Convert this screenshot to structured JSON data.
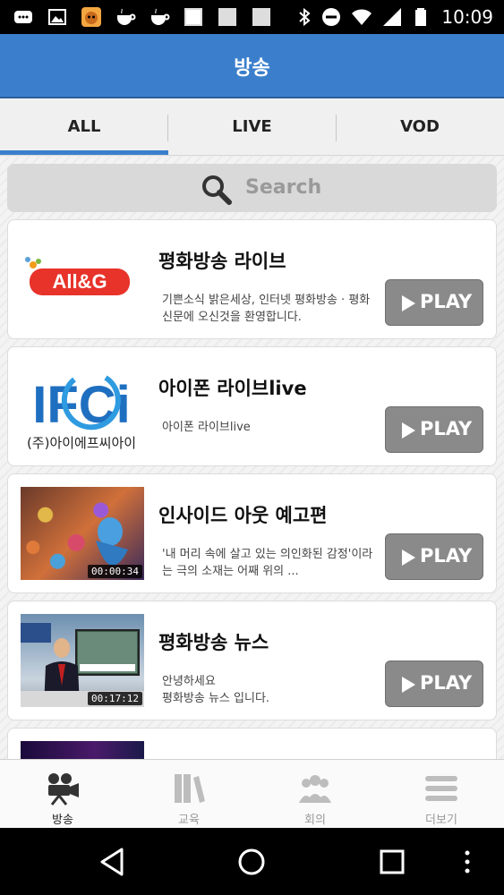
{
  "status_bar": {
    "time": "10:09"
  },
  "header": {
    "title": "방송"
  },
  "tabs": [
    {
      "label": "ALL",
      "active": true
    },
    {
      "label": "LIVE",
      "active": false
    },
    {
      "label": "VOD",
      "active": false
    }
  ],
  "search": {
    "placeholder": "Search"
  },
  "items": [
    {
      "title": "평화방송 라이브",
      "description": "기쁜소식 밝은세상, 인터넷 평화방송 · 평화신문에 오신것을 환영합니다.",
      "play_label": "PLAY",
      "logo_text": "All&G"
    },
    {
      "title": "아이폰 라이브live",
      "description": "아이폰 라이브live",
      "play_label": "PLAY",
      "logo_text": "IFCi",
      "logo_subtext": "(주)아이에프씨아이"
    },
    {
      "title": "인사이드 아웃 예고편",
      "description": "'내 머리 속에 살고 있는 의인화된 감정'이라는 극의 소재는 어째 위의 ...",
      "play_label": "PLAY",
      "duration": "00:00:34"
    },
    {
      "title": "평화방송 뉴스",
      "description": "안녕하세요\n평화방송 뉴스 입니다.",
      "play_label": "PLAY",
      "duration": "00:17:12"
    }
  ],
  "bottom_nav": [
    {
      "label": "방송",
      "icon": "camera-icon",
      "active": true
    },
    {
      "label": "교육",
      "icon": "books-icon",
      "active": false
    },
    {
      "label": "회의",
      "icon": "people-icon",
      "active": false
    },
    {
      "label": "더보기",
      "icon": "menu-icon",
      "active": false
    }
  ],
  "colors": {
    "header": "#3b7fcc",
    "play_button": "#8a8a8a",
    "tab_indicator": "#3b7fcc"
  }
}
